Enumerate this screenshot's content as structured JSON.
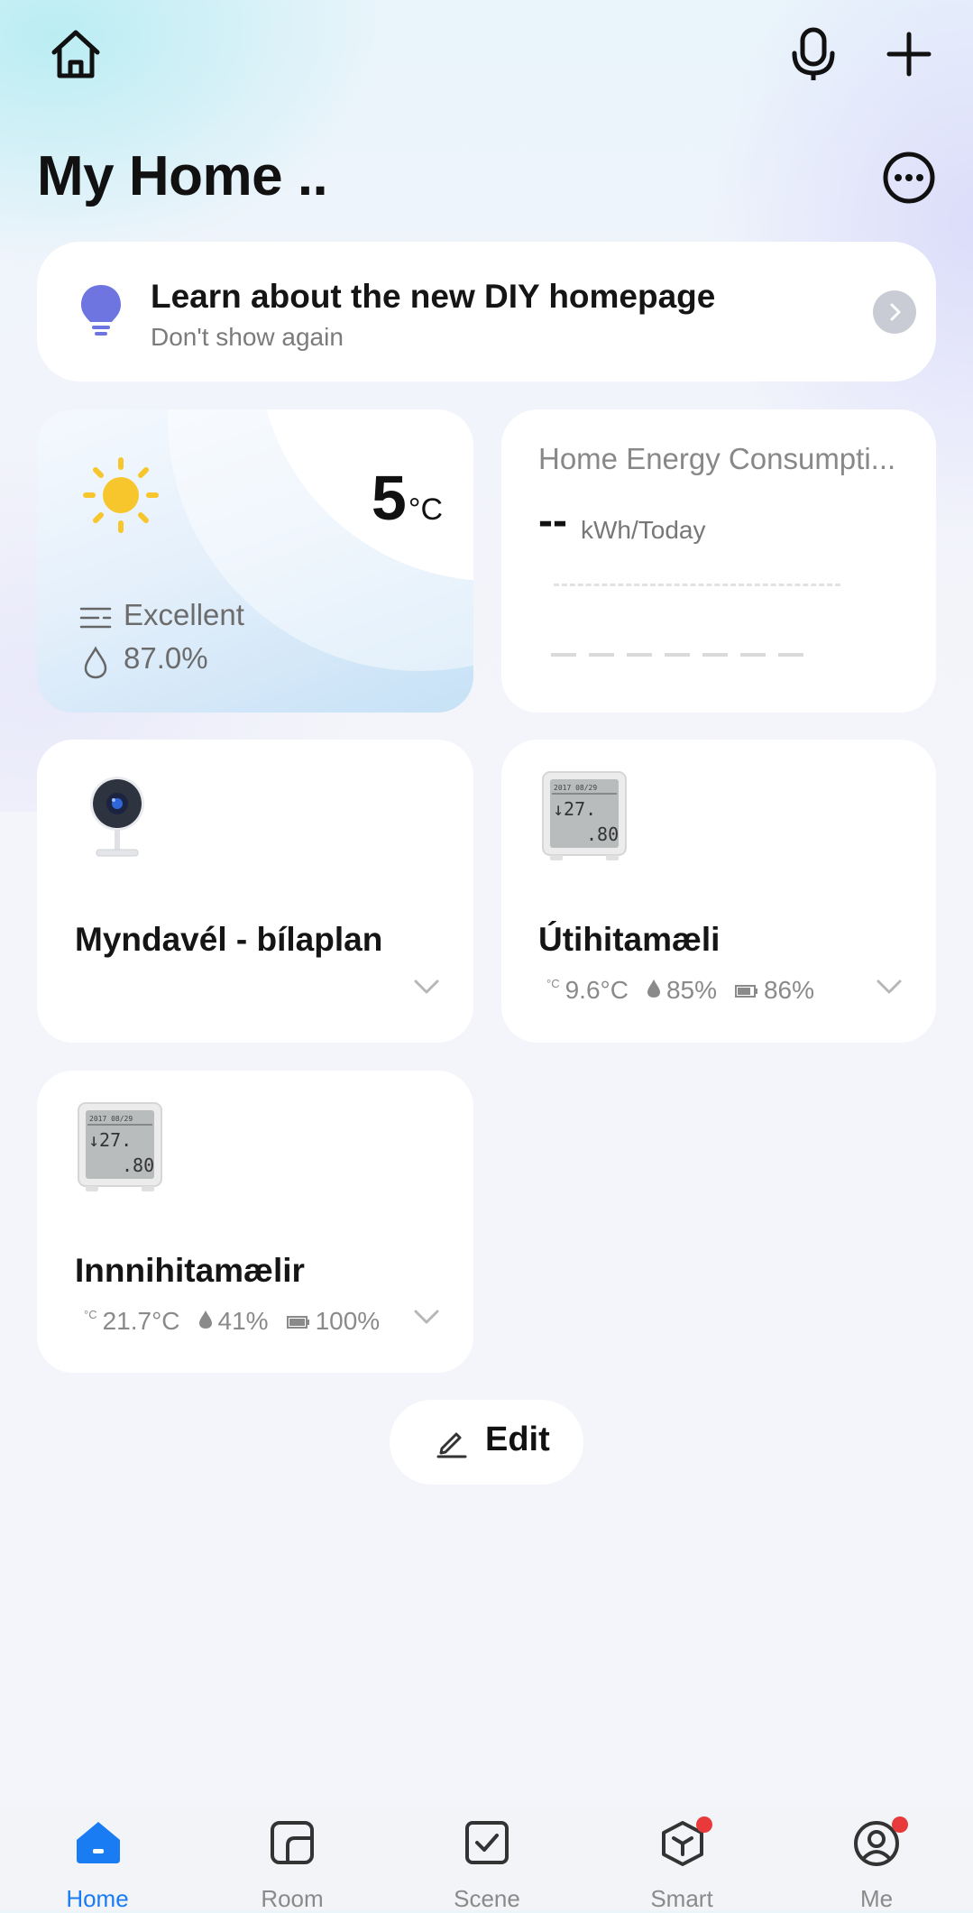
{
  "header": {
    "title": "My Home .."
  },
  "banner": {
    "title": "Learn about the new DIY homepage",
    "subtitle": "Don't show again"
  },
  "weather": {
    "temperature": "5",
    "unit": "°C",
    "air_quality": "Excellent",
    "humidity": "87.0%"
  },
  "energy": {
    "title": "Home Energy Consumpti...",
    "value": "--",
    "unit": "kWh/Today"
  },
  "devices": [
    {
      "name": "Myndavél - bílaplan"
    },
    {
      "name": "Útihitamæli",
      "temp": "9.6°C",
      "humidity": "85%",
      "battery": "86%"
    },
    {
      "name": "Innnihitamælir",
      "temp": "21.7°C",
      "humidity": "41%",
      "battery": "100%"
    }
  ],
  "edit": {
    "label": "Edit"
  },
  "nav": {
    "items": [
      {
        "label": "Home",
        "icon": "home-icon",
        "active": true
      },
      {
        "label": "Room",
        "icon": "room-icon"
      },
      {
        "label": "Scene",
        "icon": "scene-icon"
      },
      {
        "label": "Smart",
        "icon": "smart-icon",
        "badge": true
      },
      {
        "label": "Me",
        "icon": "me-icon",
        "badge": true
      }
    ]
  },
  "colors": {
    "accent": "#1a7cf2",
    "badge": "#e83a3a",
    "bulb": "#6e74e0",
    "sun": "#f6c62c"
  }
}
